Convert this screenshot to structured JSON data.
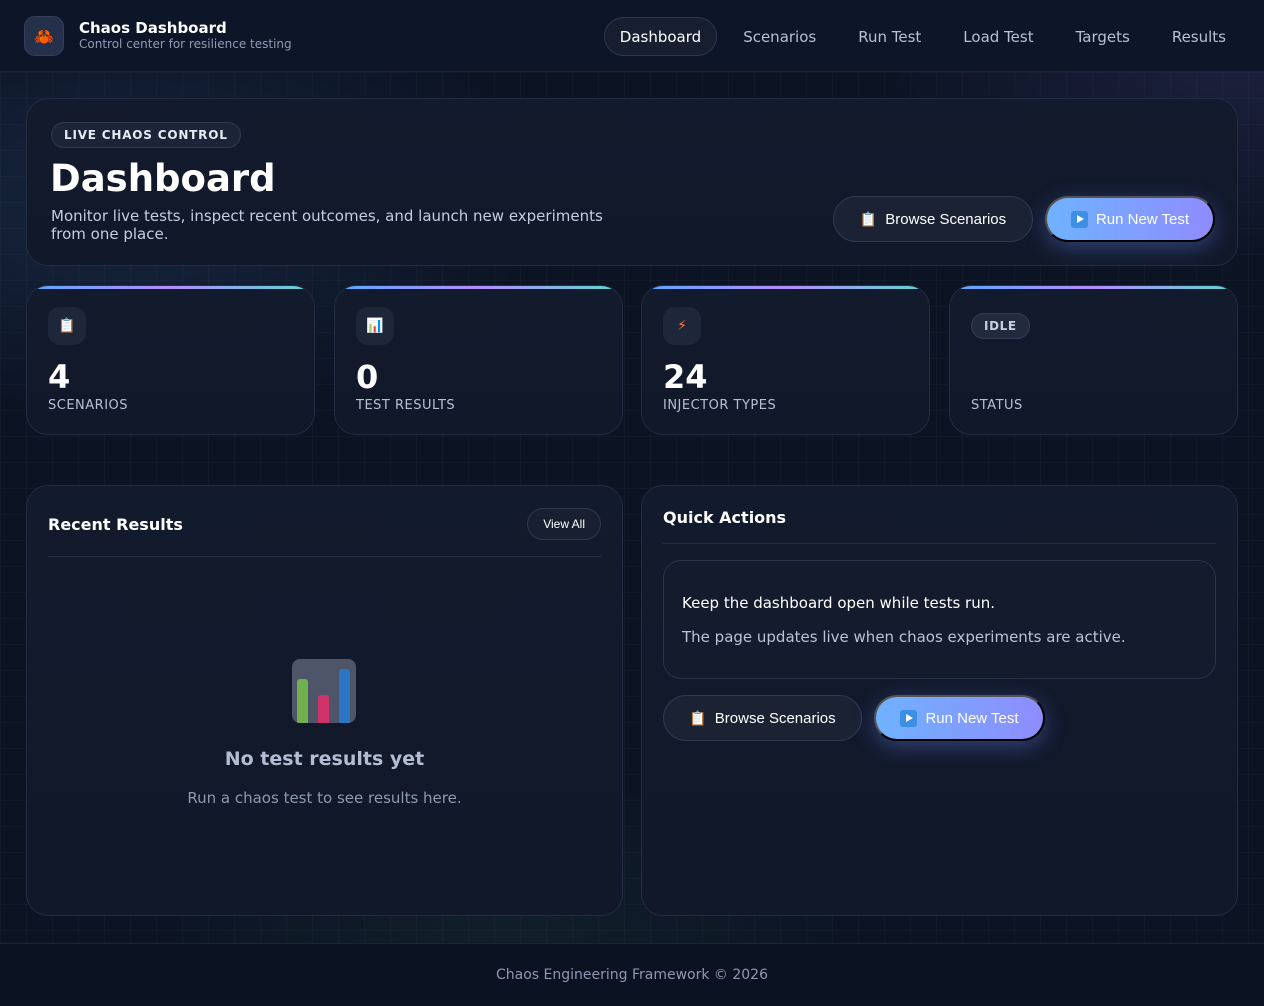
{
  "brand": {
    "icon": "crab-icon",
    "title": "Chaos Dashboard",
    "subtitle": "Control center for resilience testing"
  },
  "nav": {
    "items": [
      {
        "label": "Dashboard",
        "active": true
      },
      {
        "label": "Scenarios",
        "active": false
      },
      {
        "label": "Run Test",
        "active": false
      },
      {
        "label": "Load Test",
        "active": false
      },
      {
        "label": "Targets",
        "active": false
      },
      {
        "label": "Results",
        "active": false
      }
    ]
  },
  "hero": {
    "chip": "LIVE CHAOS CONTROL",
    "title": "Dashboard",
    "description": "Monitor live tests, inspect recent outcomes, and launch new experiments from one place.",
    "browse_label": "Browse Scenarios",
    "run_label": "Run New Test"
  },
  "stats": [
    {
      "icon": "clipboard-icon",
      "value": "4",
      "label": "SCENARIOS"
    },
    {
      "icon": "bar-chart-icon",
      "value": "0",
      "label": "TEST RESULTS"
    },
    {
      "icon": "lightning-icon",
      "value": "24",
      "label": "INJECTOR TYPES"
    },
    {
      "badge": "IDLE",
      "label": "STATUS"
    }
  ],
  "recent_results": {
    "title": "Recent Results",
    "view_all": "View All",
    "empty_title": "No test results yet",
    "empty_subtitle": "Run a chaos test to see results here."
  },
  "quick_actions": {
    "title": "Quick Actions",
    "info_head": "Keep the dashboard open while tests run.",
    "info_body": "The page updates live when chaos experiments are active.",
    "browse_label": "Browse Scenarios",
    "run_label": "Run New Test"
  },
  "footer": {
    "text": "Chaos Engineering Framework © 2026"
  },
  "colors": {
    "background": "#0c1424",
    "card": "#121a2d",
    "accent_start": "#6fb2ff",
    "accent_end": "#8f8cff"
  }
}
